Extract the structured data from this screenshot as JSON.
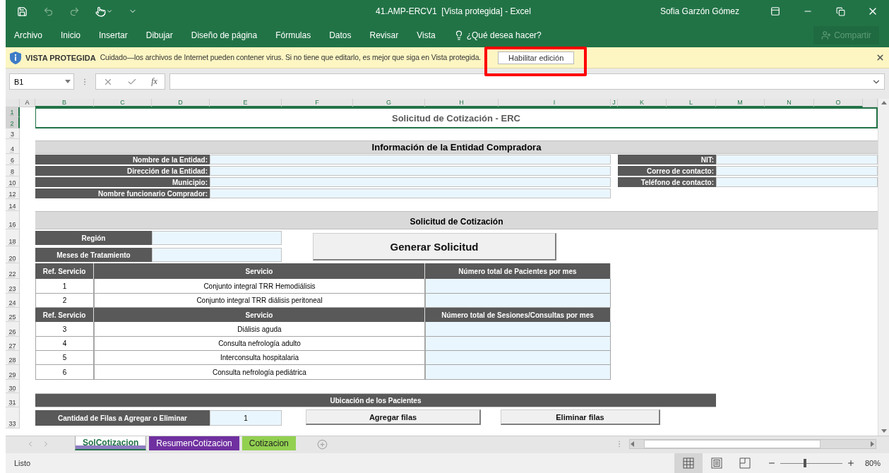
{
  "title_bar": {
    "title": "41.AMP-ERCV1  [Vista protegida] - Excel",
    "user": "Sofia Garzón Gómez"
  },
  "ribbon": {
    "tabs": [
      "Archivo",
      "Inicio",
      "Insertar",
      "Dibujar",
      "Diseño de página",
      "Fórmulas",
      "Datos",
      "Revisar",
      "Vista"
    ],
    "tell_me": "¿Qué desea hacer?",
    "share": {
      "label": "Compartir",
      "disabled": true
    }
  },
  "protected_view": {
    "heading": "VISTA PROTEGIDA",
    "message": "Cuidado—los archivos de Internet pueden contener virus. Si no tiene que editarlo, es mejor que siga en Vista protegida.",
    "button": {
      "label": "Habilitar edición",
      "highlighted": true
    }
  },
  "formula_bar": {
    "name_box": "B1",
    "function_label": "fx"
  },
  "sheet": {
    "columns": [
      {
        "label": "A",
        "selected": false
      },
      {
        "label": "B",
        "selected": true
      },
      {
        "label": "C",
        "selected": true
      },
      {
        "label": "D",
        "selected": true
      },
      {
        "label": "E",
        "selected": true
      },
      {
        "label": "F",
        "selected": true
      },
      {
        "label": "G",
        "selected": true
      },
      {
        "label": "H",
        "selected": true
      },
      {
        "label": "I",
        "selected": true
      },
      {
        "label": "J",
        "selected": true
      },
      {
        "label": "K",
        "selected": true
      },
      {
        "label": "L",
        "selected": true
      },
      {
        "label": "M",
        "selected": true
      },
      {
        "label": "N",
        "selected": true
      },
      {
        "label": "O",
        "selected": true
      }
    ],
    "rows": [
      {
        "label": "1",
        "selected": true
      },
      {
        "label": "2",
        "selected": true
      },
      {
        "label": "3",
        "selected": false
      },
      {
        "label": "4",
        "selected": false
      },
      {
        "label": "6",
        "selected": false
      },
      {
        "label": "8",
        "selected": false
      },
      {
        "label": "10",
        "selected": false
      },
      {
        "label": "12",
        "selected": false
      },
      {
        "label": "14",
        "selected": false
      },
      {
        "label": "16",
        "selected": false
      },
      {
        "label": "18",
        "selected": false
      },
      {
        "label": "20",
        "selected": false
      },
      {
        "label": "22",
        "selected": false
      },
      {
        "label": "23",
        "selected": false
      },
      {
        "label": "24",
        "selected": false
      },
      {
        "label": "25",
        "selected": false
      },
      {
        "label": "26",
        "selected": false
      },
      {
        "label": "27",
        "selected": false
      },
      {
        "label": "28",
        "selected": false
      },
      {
        "label": "29",
        "selected": false
      },
      {
        "label": "30",
        "selected": false
      },
      {
        "label": "31",
        "selected": false
      },
      {
        "label": "33",
        "selected": false
      }
    ],
    "title": "Solicitud de Cotización - ERC",
    "buyer_section": {
      "heading": "Información de la Entidad Compradora",
      "left_fields": [
        "Nombre de la Entidad:",
        "Dirección de la Entidad:",
        "Municipio:",
        "Nombre funcionario Comprador:"
      ],
      "right_fields": [
        "NIT:",
        "Correo de contacto:",
        "Teléfono de contacto:"
      ]
    },
    "request_section": {
      "heading": "Solicitud de Cotización",
      "fields": [
        "Región",
        "Meses de Tratamiento"
      ],
      "generate_button": "Generar Solicitud"
    },
    "service_groups": [
      {
        "headers": [
          "Ref. Servicio",
          "Servicio",
          "Número total de Pacientes por mes"
        ],
        "rows": [
          {
            "ref": "1",
            "service": "Conjunto integral TRR Hemodiálisis"
          },
          {
            "ref": "2",
            "service": "Conjunto integral TRR diálisis peritoneal"
          }
        ]
      },
      {
        "headers": [
          "Ref. Servicio",
          "Servicio",
          "Número total de Sesiones/Consultas por mes"
        ],
        "rows": [
          {
            "ref": "3",
            "service": "Diálisis aguda"
          },
          {
            "ref": "4",
            "service": "Consulta nefrología adulto"
          },
          {
            "ref": "5",
            "service": "Interconsulta hospitalaria"
          },
          {
            "ref": "6",
            "service": "Consulta nefrología pediátrica"
          }
        ]
      }
    ],
    "location": {
      "heading": "Ubicación de los Pacientes",
      "rows_label": "Cantidad de Filas a Agregar o Eliminar",
      "rows_value": "1",
      "buttons": [
        "Agregar filas",
        "Eliminar filas"
      ]
    }
  },
  "sheet_tabs": [
    {
      "label": "SolCotizacion",
      "selected": true,
      "color": "#8e7cc3"
    },
    {
      "label": "ResumenCotizacion",
      "selected": false,
      "color": "#7030a0"
    },
    {
      "label": "Cotizacion",
      "selected": false,
      "color": "#92d050"
    }
  ],
  "status_bar": {
    "status": "Listo",
    "views": [
      {
        "kind": "normal",
        "selected": true
      },
      {
        "kind": "page-layout",
        "selected": false
      },
      {
        "kind": "page-break",
        "selected": false
      }
    ],
    "zoom": {
      "level": 0.4,
      "label": "80%"
    }
  }
}
